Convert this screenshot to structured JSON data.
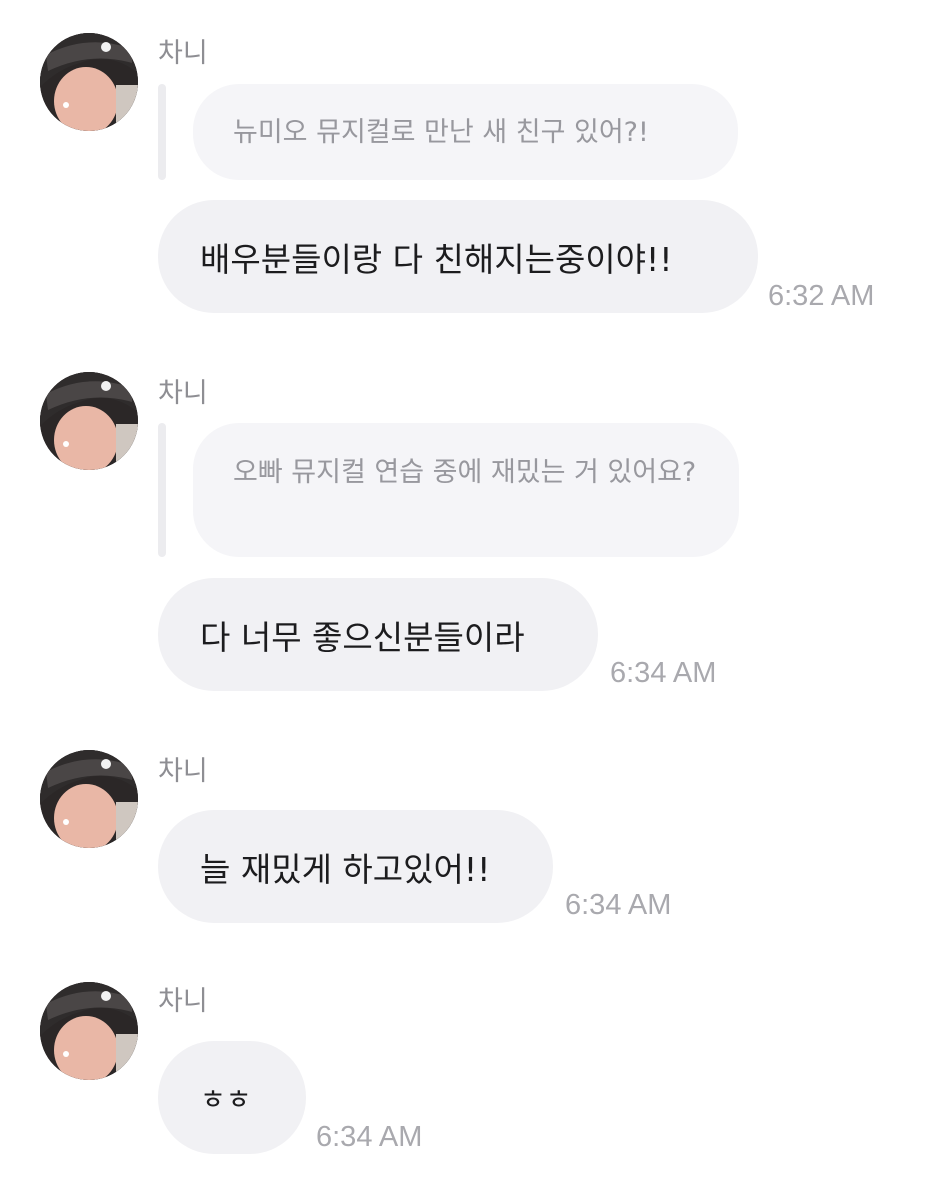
{
  "messages": [
    {
      "sender": "차니",
      "reply_to": "뉴미오 뮤지컬로 만난 새 친구 있어?!",
      "text": "배우분들이랑 다 친해지는중이야!!",
      "time": "6:32 AM"
    },
    {
      "sender": "차니",
      "reply_to": "오빠 뮤지컬 연습 중에 재밌는 거 있어요?",
      "text": "다 너무 좋으신분들이라",
      "time": "6:34 AM"
    },
    {
      "sender": "차니",
      "text": "늘 재밌게 하고있어!!",
      "time": "6:34 AM"
    },
    {
      "sender": "차니",
      "text": "ㅎㅎ",
      "time": "6:34 AM"
    }
  ],
  "colors": {
    "bubble": "#f1f1f4",
    "reply_bubble": "#f5f5f8",
    "reply_text": "#98989e",
    "text": "#1c1c1e",
    "time": "#a9a9ae",
    "sender": "#8e8e93"
  },
  "icons": {
    "avatar": "profile-photo"
  }
}
